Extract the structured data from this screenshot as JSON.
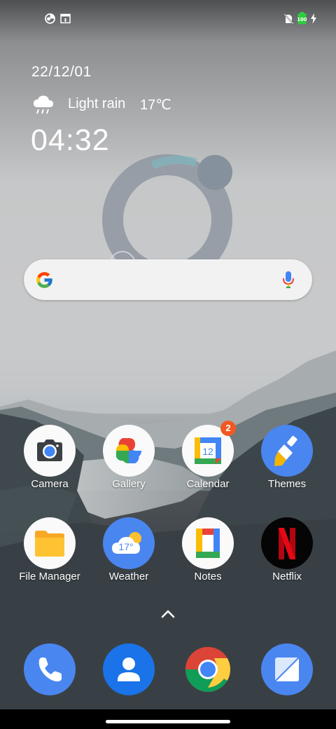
{
  "lockscreen_widget": {
    "date": "22/12/01",
    "weather": {
      "description": "Light rain",
      "temperature": "17℃",
      "icon": "cloud-rain-icon"
    },
    "time": "04:32"
  },
  "search_bar": {
    "logo": "google-g-icon",
    "mic": "microphone-icon"
  },
  "apps_row1": [
    {
      "label": "Camera",
      "icon": "camera-icon"
    },
    {
      "label": "Gallery",
      "icon": "pinwheel-icon"
    },
    {
      "label": "Calendar",
      "icon": "calendar-icon",
      "badge": "2",
      "calendar_date": "12"
    },
    {
      "label": "Themes",
      "icon": "paint-brush-icon"
    }
  ],
  "apps_row2": [
    {
      "label": "File Manager",
      "icon": "folder-icon"
    },
    {
      "label": "Weather",
      "icon": "weather-icon",
      "temp": "17°"
    },
    {
      "label": "Notes",
      "icon": "notes-icon"
    },
    {
      "label": "Netflix",
      "icon": "netflix-icon"
    }
  ],
  "dock": [
    {
      "icon": "phone-icon"
    },
    {
      "icon": "contacts-icon"
    },
    {
      "icon": "chrome-icon"
    },
    {
      "icon": "messages-icon"
    }
  ],
  "status_bar": {
    "left_icons": [
      "data-saver-icon",
      "notification-icon"
    ],
    "right_icons": [
      "no-sim-icon",
      "battery-charging-icon",
      "charging-bolt-icon"
    ],
    "battery_level_text": "100"
  },
  "colors": {
    "badge": "#f05a22",
    "accent_blue": "#4285f4",
    "netflix_red": "#e50914"
  }
}
